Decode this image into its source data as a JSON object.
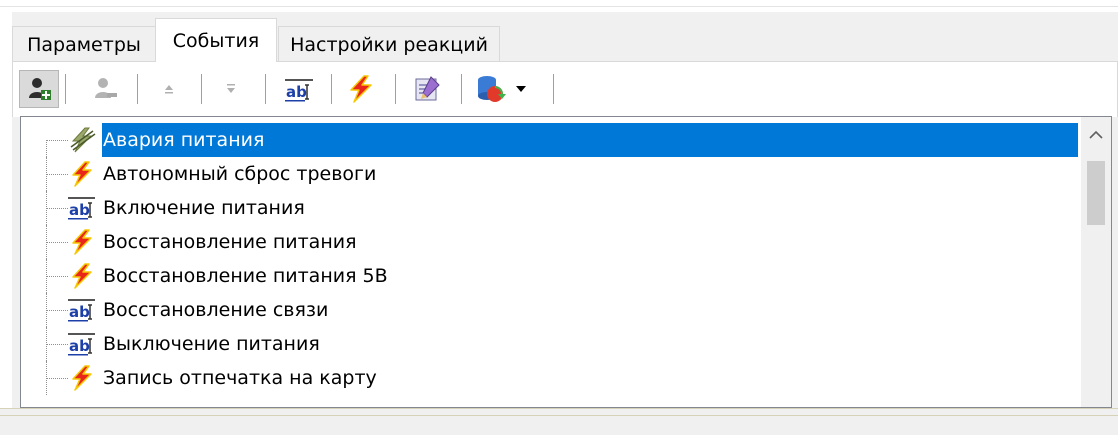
{
  "tabs": [
    {
      "label": "Параметры",
      "active": false
    },
    {
      "label": "События",
      "active": true
    },
    {
      "label": "Настройки реакций",
      "active": false
    }
  ],
  "toolbar": {
    "buttons": [
      {
        "icon": "add-user-icon",
        "state": "pressed"
      },
      {
        "icon": "remove-user-icon",
        "state": "disabled"
      },
      {
        "icon": "move-up-icon",
        "state": "disabled"
      },
      {
        "icon": "move-down-icon",
        "state": "disabled"
      },
      {
        "icon": "text-event-icon",
        "state": "normal"
      },
      {
        "icon": "lightning-event-icon",
        "state": "normal"
      },
      {
        "icon": "edit-properties-icon",
        "state": "normal"
      },
      {
        "icon": "database-action-icon",
        "state": "normal"
      }
    ]
  },
  "events": [
    {
      "label": "Авария питания",
      "icon": "lightning-crossed-icon",
      "selected": true
    },
    {
      "label": "Автономный сброс тревоги",
      "icon": "lightning-icon",
      "selected": false
    },
    {
      "label": "Включение питания",
      "icon": "text-event-icon",
      "selected": false
    },
    {
      "label": "Восстановление питания",
      "icon": "lightning-icon",
      "selected": false
    },
    {
      "label": "Восстановление питания 5В",
      "icon": "lightning-icon",
      "selected": false
    },
    {
      "label": "Восстановление связи",
      "icon": "text-event-icon",
      "selected": false
    },
    {
      "label": "Выключение питания",
      "icon": "text-event-icon",
      "selected": false
    },
    {
      "label": "Запись отпечатка на карту",
      "icon": "lightning-icon",
      "selected": false
    }
  ],
  "colors": {
    "selection": "#0078d7",
    "lightning": "#e8261c",
    "lightning_outline": "#f5c800"
  }
}
